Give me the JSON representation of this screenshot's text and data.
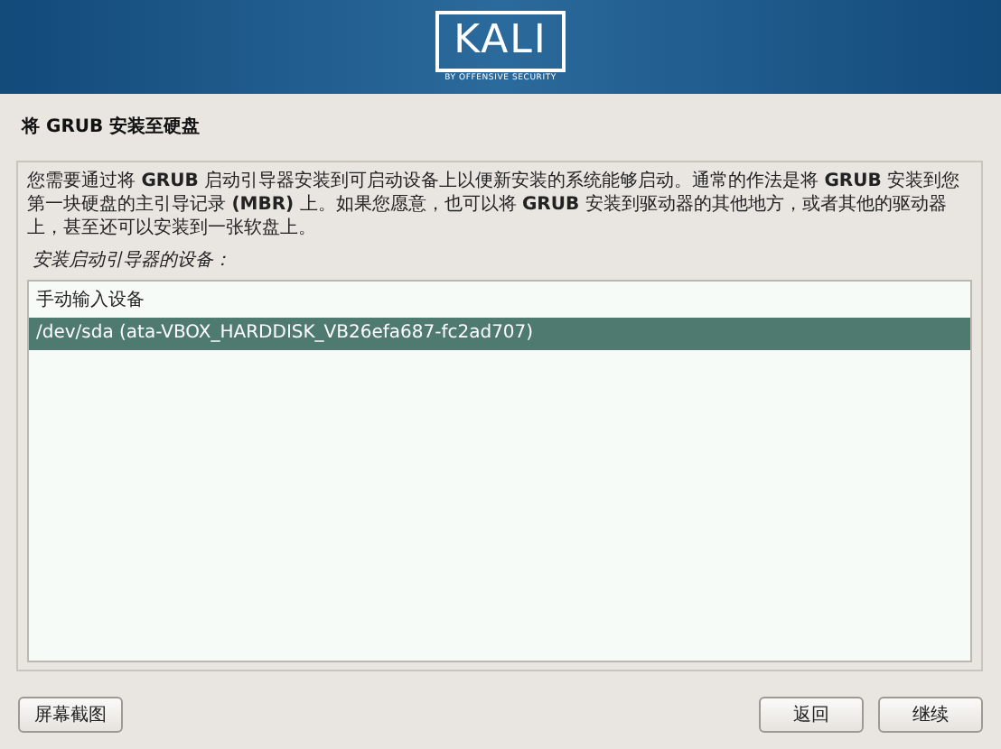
{
  "banner": {
    "logo": "KALI",
    "tagline": "BY OFFENSIVE SECURITY"
  },
  "title": "将 GRUB 安装至硬盘",
  "description": "您需要通过将 **GRUB** 启动引导器安装到可启动设备上以便新安装的系统能够启动。通常的作法是将 **GRUB** 安装到您第一块硬盘的主引导记录 **(MBR)** 上。如果您愿意，也可以将 **GRUB** 安装到驱动器的其他地方，或者其他的驱动器上，甚至还可以安装到一张软盘上。",
  "prompt": "安装启动引导器的设备：",
  "devices": [
    {
      "label": "手动输入设备",
      "selected": false
    },
    {
      "label": "/dev/sda  (ata-VBOX_HARDDISK_VB26efa687-fc2ad707)",
      "selected": true
    }
  ],
  "buttons": {
    "screenshot": "屏幕截图",
    "back": "返回",
    "continue": "继续"
  }
}
